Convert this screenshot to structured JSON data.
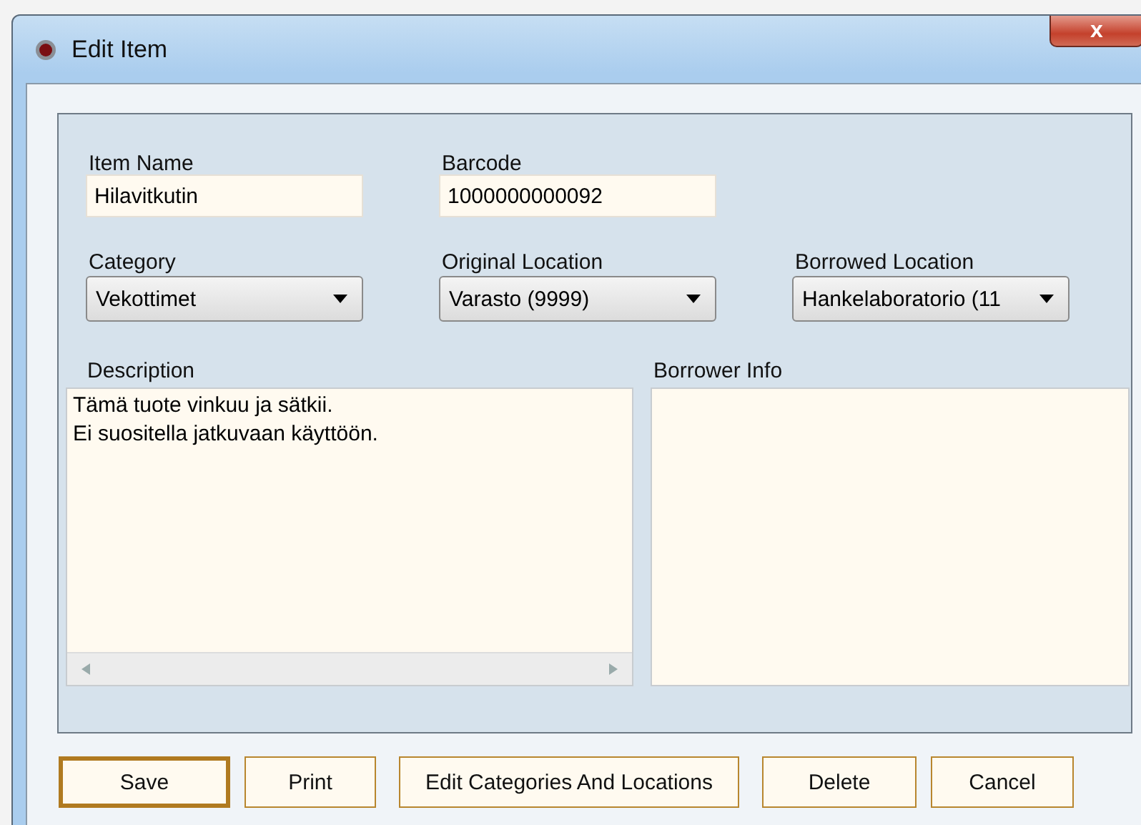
{
  "window": {
    "title": "Edit Item",
    "close_glyph": "x"
  },
  "fields": [
    {
      "label": "Item Name",
      "value": "Hilavitkutin"
    },
    {
      "label": "Barcode",
      "value": "1000000000092"
    }
  ],
  "dropdowns": [
    {
      "label": "Category",
      "value": "Vekottimet"
    },
    {
      "label": "Original Location",
      "value": "Varasto (9999)"
    },
    {
      "label": "Borrowed Location",
      "value": "Hankelaboratorio (11"
    }
  ],
  "description": {
    "label": "Description",
    "lines": [
      "Tämä tuote vinkuu ja sätkii.",
      "Ei suositella jatkuvaan käyttöön."
    ]
  },
  "borrower_info": {
    "label": "Borrower Info"
  },
  "buttons": [
    {
      "label": "Save",
      "default": true
    },
    {
      "label": "Print",
      "default": false
    },
    {
      "label": "Edit Categories And Locations",
      "default": false
    },
    {
      "label": "Delete",
      "default": false
    },
    {
      "label": "Cancel",
      "default": false
    }
  ]
}
